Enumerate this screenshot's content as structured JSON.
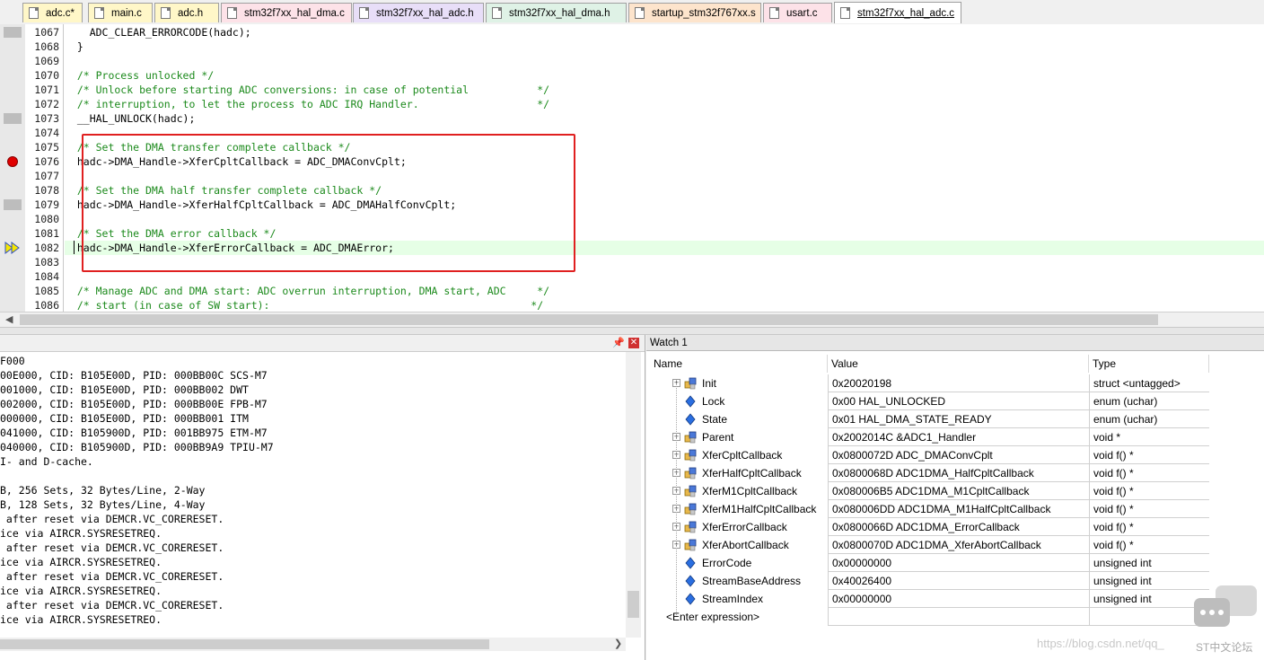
{
  "tabs": [
    {
      "label": "adc.c*",
      "color": "#fff7c8",
      "active": false
    },
    {
      "label": "main.c",
      "color": "#fff7c8",
      "active": false
    },
    {
      "label": "adc.h",
      "color": "#fff7c8",
      "active": false
    },
    {
      "label": "stm32f7xx_hal_dma.c",
      "color": "#fde2e8",
      "active": false
    },
    {
      "label": "stm32f7xx_hal_adc.h",
      "color": "#e8def8",
      "active": false
    },
    {
      "label": "stm32f7xx_hal_dma.h",
      "color": "#dff2e6",
      "active": false
    },
    {
      "label": "startup_stm32f767xx.s",
      "color": "#fde4cc",
      "active": false
    },
    {
      "label": "usart.c",
      "color": "#fde2e8",
      "active": false
    },
    {
      "label": "stm32f7xx_hal_adc.c",
      "color": "#ffffff",
      "active": true
    }
  ],
  "editor": {
    "lines": [
      {
        "num": "1067",
        "code": "    ADC_CLEAR_ERRORCODE(hadc);",
        "comment": false,
        "marker": "gray"
      },
      {
        "num": "1068",
        "code": "  }",
        "comment": false,
        "marker": ""
      },
      {
        "num": "1069",
        "code": "",
        "comment": false,
        "marker": ""
      },
      {
        "num": "1070",
        "code": "  /* Process unlocked */",
        "comment": true,
        "marker": ""
      },
      {
        "num": "1071",
        "code": "  /* Unlock before starting ADC conversions: in case of potential           */",
        "comment": true,
        "marker": ""
      },
      {
        "num": "1072",
        "code": "  /* interruption, to let the process to ADC IRQ Handler.                   */",
        "comment": true,
        "marker": ""
      },
      {
        "num": "1073",
        "code": "  __HAL_UNLOCK(hadc);",
        "comment": false,
        "marker": "gray"
      },
      {
        "num": "1074",
        "code": "",
        "comment": false,
        "marker": ""
      },
      {
        "num": "1075",
        "code": "  /* Set the DMA transfer complete callback */",
        "comment": true,
        "marker": ""
      },
      {
        "num": "1076",
        "code": "  hadc->DMA_Handle->XferCpltCallback = ADC_DMAConvCplt;",
        "comment": false,
        "marker": "breakpoint"
      },
      {
        "num": "1077",
        "code": "",
        "comment": false,
        "marker": ""
      },
      {
        "num": "1078",
        "code": "  /* Set the DMA half transfer complete callback */",
        "comment": true,
        "marker": ""
      },
      {
        "num": "1079",
        "code": "  hadc->DMA_Handle->XferHalfCpltCallback = ADC_DMAHalfConvCplt;",
        "comment": false,
        "marker": "gray"
      },
      {
        "num": "1080",
        "code": "",
        "comment": false,
        "marker": ""
      },
      {
        "num": "1081",
        "code": "  /* Set the DMA error callback */",
        "comment": true,
        "marker": ""
      },
      {
        "num": "1082",
        "code": "  hadc->DMA_Handle->XferErrorCallback = ADC_DMAError;",
        "comment": false,
        "marker": "current"
      },
      {
        "num": "1083",
        "code": "",
        "comment": false,
        "marker": ""
      },
      {
        "num": "1084",
        "code": "",
        "comment": false,
        "marker": ""
      },
      {
        "num": "1085",
        "code": "  /* Manage ADC and DMA start: ADC overrun interruption, DMA start, ADC     */",
        "comment": true,
        "marker": ""
      },
      {
        "num": "1086",
        "code": "  /* start (in case of SW start):                                          */",
        "comment": true,
        "marker": ""
      }
    ]
  },
  "command": {
    "lines": [
      "F000",
      "00E000, CID: B105E00D, PID: 000BB00C SCS-M7",
      "001000, CID: B105E00D, PID: 000BB002 DWT",
      "002000, CID: B105E00D, PID: 000BB00E FPB-M7",
      "000000, CID: B105E00D, PID: 000BB001 ITM",
      "041000, CID: B105900D, PID: 001BB975 ETM-M7",
      "040000, CID: B105900D, PID: 000BB9A9 TPIU-M7",
      "I- and D-cache.",
      "",
      "B, 256 Sets, 32 Bytes/Line, 2-Way",
      "B, 128 Sets, 32 Bytes/Line, 4-Way",
      " after reset via DEMCR.VC_CORERESET.",
      "ice via AIRCR.SYSRESETREQ.",
      " after reset via DEMCR.VC_CORERESET.",
      "ice via AIRCR.SYSRESETREQ.",
      " after reset via DEMCR.VC_CORERESET.",
      "ice via AIRCR.SYSRESETREQ.",
      " after reset via DEMCR.VC_CORERESET.",
      "ice via AIRCR.SYSRESETREQ."
    ]
  },
  "watch": {
    "title": "Watch 1",
    "headers": {
      "name": "Name",
      "value": "Value",
      "type": "Type"
    },
    "rows": [
      {
        "name": "Init",
        "value": "0x20020198",
        "type": "struct <untagged>",
        "expandable": true,
        "icon": "struct-icon"
      },
      {
        "name": "Lock",
        "value": "0x00 HAL_UNLOCKED",
        "type": "enum (uchar)",
        "expandable": false,
        "icon": "variable-icon"
      },
      {
        "name": "State",
        "value": "0x01 HAL_DMA_STATE_READY",
        "type": "enum (uchar)",
        "expandable": false,
        "icon": "variable-icon"
      },
      {
        "name": "Parent",
        "value": "0x2002014C &ADC1_Handler",
        "type": "void *",
        "expandable": true,
        "icon": "struct-icon"
      },
      {
        "name": "XferCpltCallback",
        "value": "0x0800072D ADC_DMAConvCplt",
        "type": "void f()  *",
        "expandable": true,
        "icon": "struct-icon"
      },
      {
        "name": "XferHalfCpltCallback",
        "value": "0x0800068D ADC1DMA_HalfCpltCallback",
        "type": "void f()  *",
        "expandable": true,
        "icon": "struct-icon"
      },
      {
        "name": "XferM1CpltCallback",
        "value": "0x080006B5 ADC1DMA_M1CpltCallback",
        "type": "void f()  *",
        "expandable": true,
        "icon": "struct-icon"
      },
      {
        "name": "XferM1HalfCpltCallback",
        "value": "0x080006DD ADC1DMA_M1HalfCpltCallback",
        "type": "void f()  *",
        "expandable": true,
        "icon": "struct-icon"
      },
      {
        "name": "XferErrorCallback",
        "value": "0x0800066D ADC1DMA_ErrorCallback",
        "type": "void f()  *",
        "expandable": true,
        "icon": "struct-icon"
      },
      {
        "name": "XferAbortCallback",
        "value": "0x0800070D ADC1DMA_XferAbortCallback",
        "type": "void f()  *",
        "expandable": true,
        "icon": "struct-icon"
      },
      {
        "name": "ErrorCode",
        "value": "0x00000000",
        "type": "unsigned int",
        "expandable": false,
        "icon": "variable-icon"
      },
      {
        "name": "StreamBaseAddress",
        "value": "0x40026400",
        "type": "unsigned int",
        "expandable": false,
        "icon": "variable-icon"
      },
      {
        "name": "StreamIndex",
        "value": "0x00000000",
        "type": "unsigned int",
        "expandable": false,
        "icon": "variable-icon"
      }
    ],
    "enter_expression": "<Enter expression>"
  },
  "watermark": "https://blog.csdn.net/qq_",
  "logo_text": "ST中文论坛",
  "colors": {
    "comment": "#1c8a1c",
    "highlight": "#e6ffe6",
    "redbox": "#e02020"
  }
}
